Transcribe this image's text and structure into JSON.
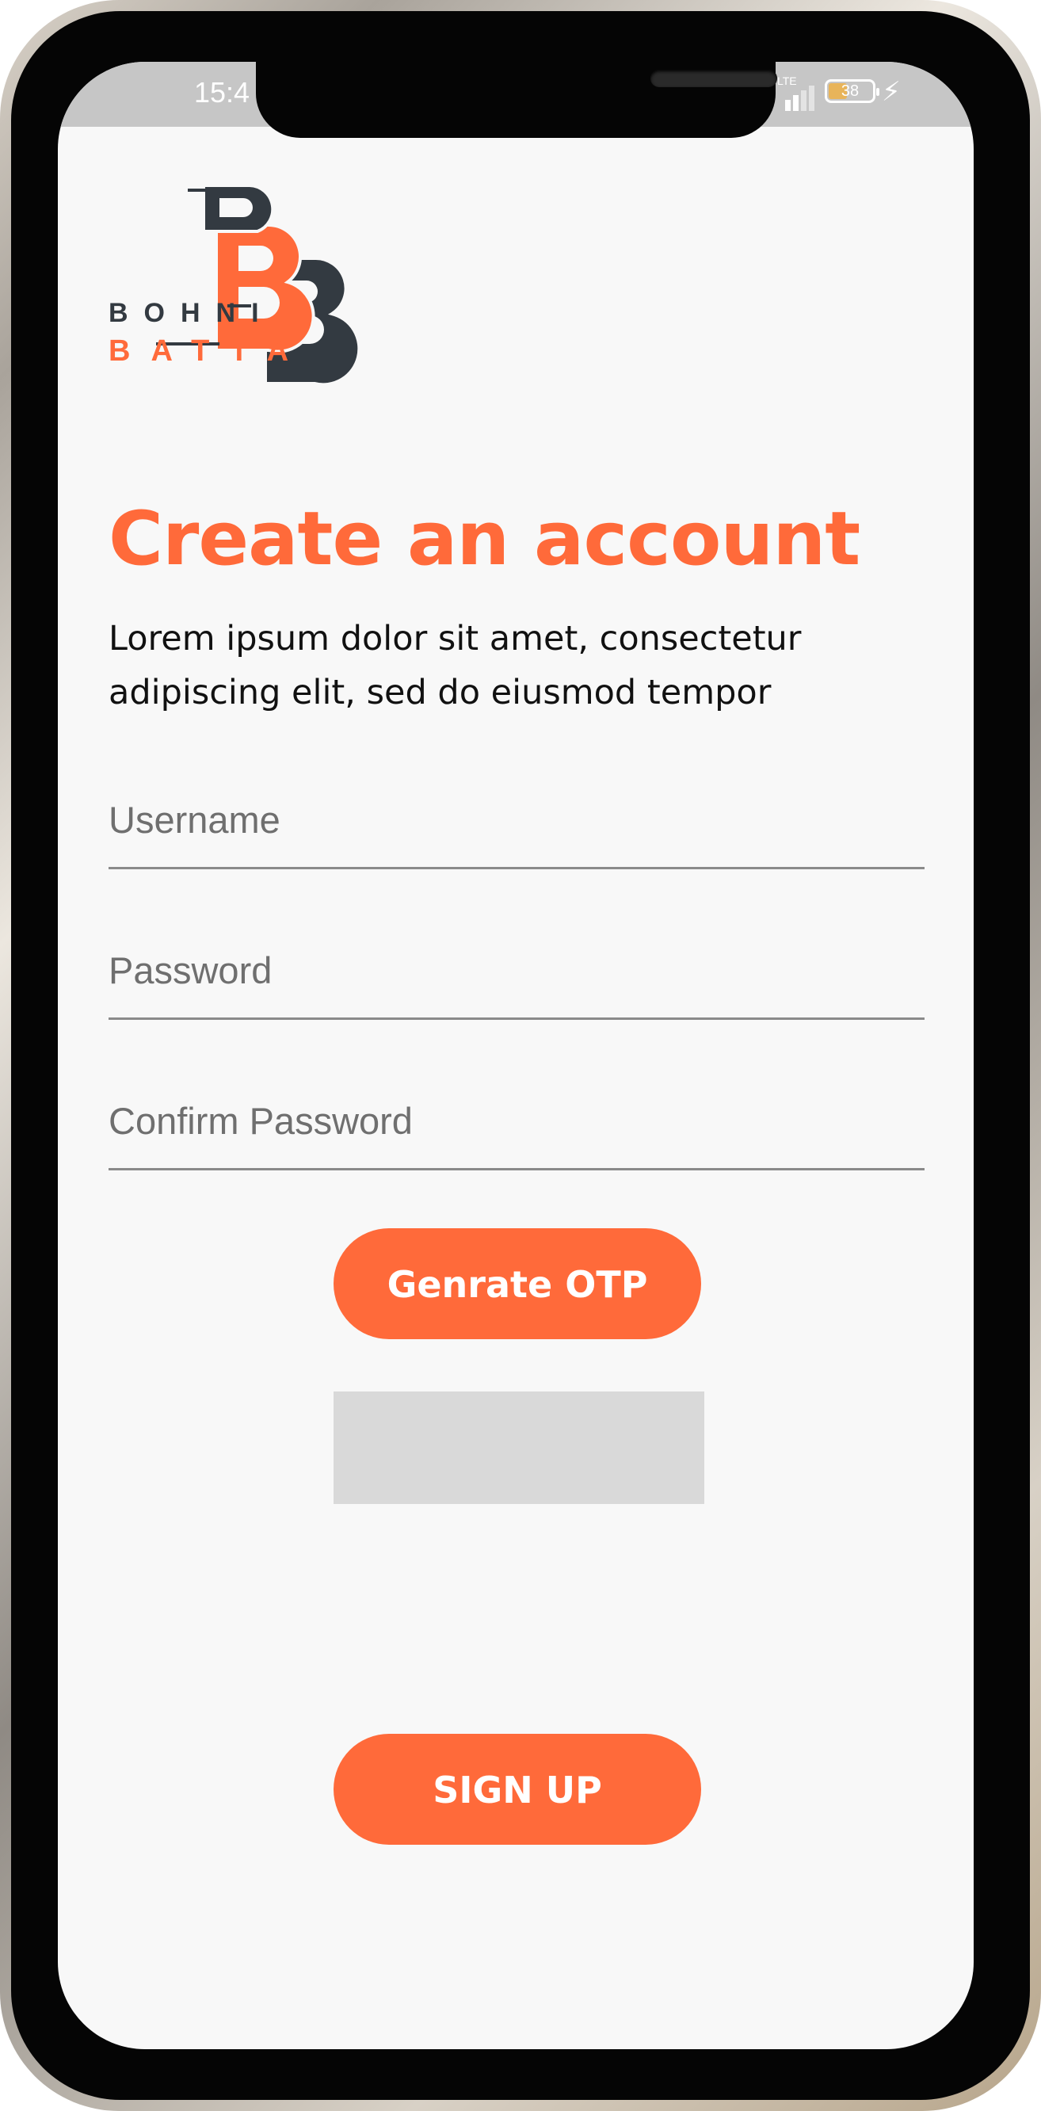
{
  "status_bar": {
    "time": "15:4",
    "network": "LTE",
    "battery": "38",
    "icons": [
      "signal-icon",
      "battery-icon",
      "charging-icon"
    ]
  },
  "brand": {
    "line1": "BOHNI",
    "line2": "BATTA",
    "monogram": "BB",
    "colors": {
      "accent": "#ff6a3a",
      "dark": "#333a41"
    }
  },
  "page": {
    "title": "Create an account",
    "description": "Lorem ipsum dolor sit amet, consectetur adipiscing elit, sed do eiusmod tempor"
  },
  "form": {
    "username": {
      "placeholder": "Username",
      "value": ""
    },
    "password": {
      "placeholder": "Password",
      "value": ""
    },
    "confirm_password": {
      "placeholder": "Confirm Password",
      "value": ""
    },
    "otp_button": "Genrate OTP",
    "otp_value": "",
    "signup_button": "SIGN UP"
  },
  "colors": {
    "accent": "#ff6a3a",
    "background": "#f8f8f8",
    "otp_box": "#d9d9d9",
    "status_bar": "#c6c6c6"
  }
}
